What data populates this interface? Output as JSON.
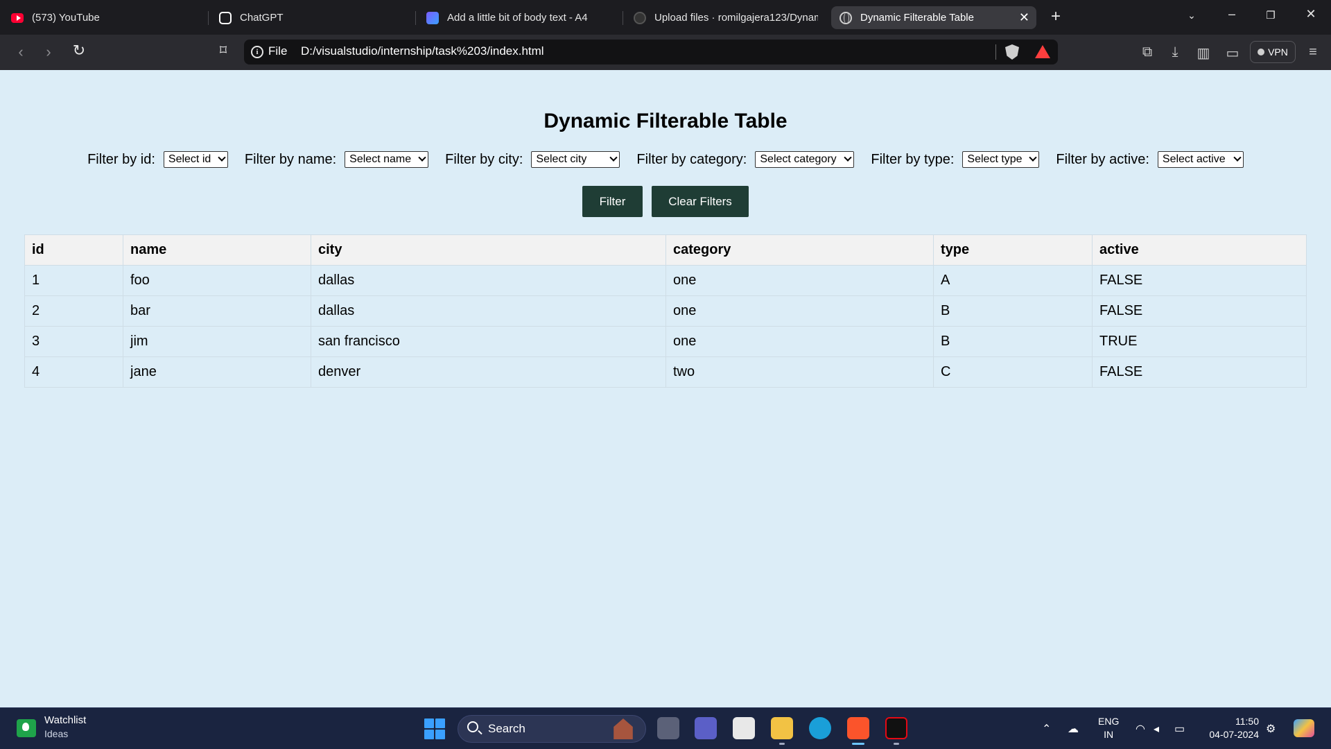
{
  "browser": {
    "tabs": [
      {
        "title": "(573) YouTube",
        "icon": "youtube-icon"
      },
      {
        "title": "ChatGPT",
        "icon": "chatgpt-icon"
      },
      {
        "title": "Add a little bit of body text - A4",
        "icon": "doc-icon"
      },
      {
        "title": "Upload files · romilgajera123/Dynam",
        "icon": "github-icon"
      },
      {
        "title": "Dynamic Filterable Table",
        "icon": "globe-icon"
      }
    ],
    "address": {
      "scheme": "File",
      "url": "D:/visualstudio/internship/task%203/index.html"
    },
    "vpn_label": "VPN"
  },
  "page": {
    "title": "Dynamic Filterable Table",
    "filters": [
      {
        "label": "Filter by id:",
        "selected": "Select id"
      },
      {
        "label": "Filter by name:",
        "selected": "Select name"
      },
      {
        "label": "Filter by city:",
        "selected": "Select city"
      },
      {
        "label": "Filter by category:",
        "selected": "Select category"
      },
      {
        "label": "Filter by type:",
        "selected": "Select type"
      },
      {
        "label": "Filter by active:",
        "selected": "Select active"
      }
    ],
    "buttons": {
      "filter": "Filter",
      "clear": "Clear Filters"
    },
    "button_color": "#1f3d35",
    "background": "#dcedf7",
    "table": {
      "headers": [
        "id",
        "name",
        "city",
        "category",
        "type",
        "active"
      ],
      "rows": [
        [
          "1",
          "foo",
          "dallas",
          "one",
          "A",
          "FALSE"
        ],
        [
          "2",
          "bar",
          "dallas",
          "one",
          "B",
          "FALSE"
        ],
        [
          "3",
          "jim",
          "san francisco",
          "one",
          "B",
          "TRUE"
        ],
        [
          "4",
          "jane",
          "denver",
          "two",
          "C",
          "FALSE"
        ]
      ]
    }
  },
  "taskbar": {
    "widget": {
      "title": "Watchlist",
      "subtitle": "Ideas"
    },
    "search_label": "Search",
    "language": {
      "line1": "ENG",
      "line2": "IN"
    },
    "clock": {
      "time": "11:50",
      "date": "04-07-2024"
    }
  }
}
